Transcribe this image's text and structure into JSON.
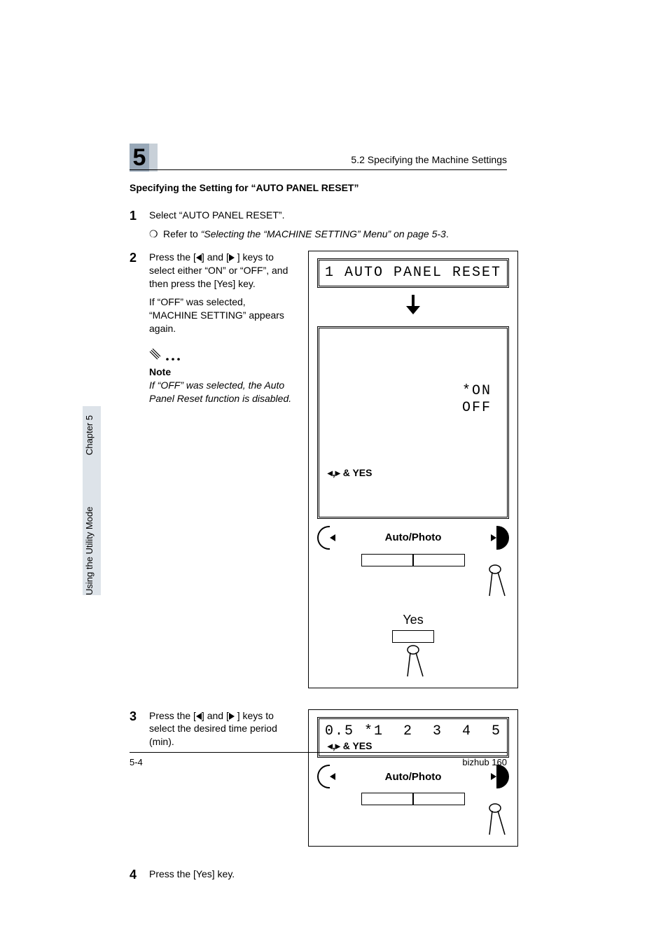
{
  "header": {
    "chapter_number": "5",
    "section_ref": "5.2 Specifying the Machine Settings"
  },
  "sidebar": {
    "chapter_label": "Chapter 5",
    "mode_label": "Using the Utility Mode"
  },
  "section_title": "Specifying the Setting for “AUTO PANEL RESET”",
  "steps": {
    "s1": {
      "num": "1",
      "text": "Select “AUTO PANEL RESET”.",
      "sub_marker": "❍",
      "sub_prefix": "Refer to ",
      "sub_ital": "“Selecting the “MACHINE SETTING” Menu” on page 5-3",
      "sub_suffix": "."
    },
    "s2": {
      "num": "2",
      "p1a": "Press the [",
      "p1b": "] and [",
      "p1c": "] keys to select either “ON” or “OFF”, and then press the [Yes] key.",
      "p2": "If “OFF” was selected, “MACHINE SETTING” appears again."
    },
    "note": {
      "heading": "Note",
      "text": "If “OFF” was selected, the Auto Panel Reset function is disabled."
    },
    "s3": {
      "num": "3",
      "p1a": "Press the [",
      "p1b": "] and [",
      "p1c": "] keys to select the desired time period (min)."
    },
    "s4": {
      "num": "4",
      "text": "Press the [Yes] key."
    }
  },
  "figure1": {
    "lcd_top": "1 AUTO PANEL RESET",
    "lcd2_left": "*ON",
    "lcd2_right": "OFF",
    "lcd2_line2": " ◂,▸ & YES",
    "rocker_label": "Auto/Photo",
    "yes_label": "Yes"
  },
  "figure2": {
    "lcd_line1": "0.5 *1  2  3  4  5",
    "lcd_line2": " ◂,▸ & YES",
    "rocker_label": "Auto/Photo"
  },
  "footer": {
    "page": "5-4",
    "product": "bizhub 160"
  }
}
